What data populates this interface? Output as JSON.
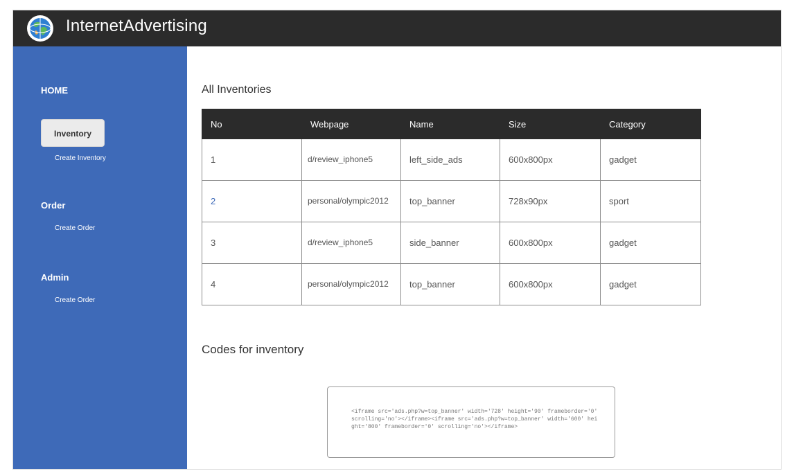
{
  "header": {
    "brand": "InternetAdvertising",
    "logo_icon": "globe-icon"
  },
  "sidebar": {
    "home_label": "HOME",
    "inventory_label": "Inventory",
    "create_inventory_label": "Create Inventory",
    "order_label": "Order",
    "create_order_label": "Create Order",
    "admin_label": "Admin",
    "admin_create_order_label": "Create Order",
    "color": "#3e6ab8"
  },
  "main": {
    "title": "All Inventories",
    "table": {
      "headers": [
        "No",
        "Webpage",
        "Name",
        "Size",
        "Category"
      ],
      "rows": [
        [
          "1",
          "d/review_iphone5",
          "left_side_ads",
          "600x800px",
          "gadget"
        ],
        [
          "2",
          "personal/olympic2012",
          "top_banner",
          "728x90px",
          "sport"
        ],
        [
          "3",
          "d/review_iphone5",
          "side_banner",
          "600x800px",
          "gadget"
        ],
        [
          "4",
          "personal/olympic2012",
          "top_banner",
          "600x800px",
          "gadget"
        ]
      ]
    },
    "codes_title": "Codes for inventory",
    "code_text": "<iframe src='ads.php?w=top_banner' width='728' height='90' frameborder='0' scrolling='no'></iframe><iframe src='ads.php?w=top_banner' width='600' height='800' frameborder='0' scrolling='no'></iframe>"
  }
}
